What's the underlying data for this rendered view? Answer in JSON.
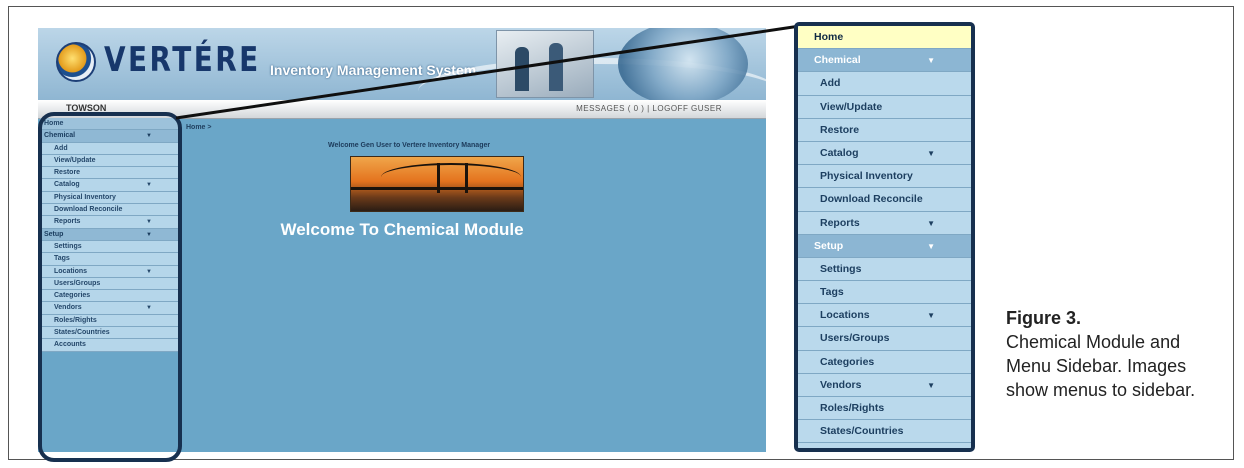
{
  "app": {
    "logo_text": "VERTÉRE",
    "logo_subtitle": "Inventory Management System",
    "site_name": "TOWSON",
    "top_links": "MESSAGES ( 0 ) | LOGOFF GUSER"
  },
  "breadcrumb": "Home >",
  "main": {
    "welcome_small": "Welcome Gen User to Vertere Inventory Manager",
    "welcome_big": "Welcome To Chemical Module"
  },
  "menu": [
    {
      "label": "Home",
      "kind": "home",
      "caret": ""
    },
    {
      "label": "Chemical",
      "kind": "top",
      "caret": "▼"
    },
    {
      "label": "Add",
      "kind": "sub",
      "caret": ""
    },
    {
      "label": "View/Update",
      "kind": "sub",
      "caret": ""
    },
    {
      "label": "Restore",
      "kind": "sub",
      "caret": ""
    },
    {
      "label": "Catalog",
      "kind": "sub",
      "caret": "▼"
    },
    {
      "label": "Physical Inventory",
      "kind": "sub",
      "caret": ""
    },
    {
      "label": "Download Reconcile",
      "kind": "sub",
      "caret": ""
    },
    {
      "label": "Reports",
      "kind": "sub",
      "caret": "▼"
    },
    {
      "label": "Setup",
      "kind": "top",
      "caret": "▼"
    },
    {
      "label": "Settings",
      "kind": "sub",
      "caret": ""
    },
    {
      "label": "Tags",
      "kind": "sub",
      "caret": ""
    },
    {
      "label": "Locations",
      "kind": "sub",
      "caret": "▼"
    },
    {
      "label": "Users/Groups",
      "kind": "sub",
      "caret": ""
    },
    {
      "label": "Categories",
      "kind": "sub",
      "caret": ""
    },
    {
      "label": "Vendors",
      "kind": "sub",
      "caret": "▼"
    },
    {
      "label": "Roles/Rights",
      "kind": "sub",
      "caret": ""
    },
    {
      "label": "States/Countries",
      "kind": "sub",
      "caret": ""
    },
    {
      "label": "Accounts",
      "kind": "sub",
      "caret": ""
    }
  ],
  "caption": {
    "label": "Figure 3.",
    "text": "Chemical Module and Menu Sidebar. Images show menus to sidebar."
  },
  "colors": {
    "page_bg": "#6aa6c8",
    "menu_item": "#bad9ec",
    "menu_header": "#8cb6d3",
    "home_highlight": "#ffffc4",
    "outline": "#17304f"
  }
}
